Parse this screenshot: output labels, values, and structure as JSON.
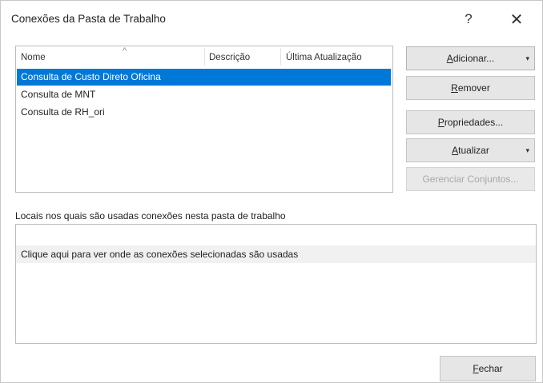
{
  "window": {
    "title": "Conexões da Pasta de Trabalho",
    "help_glyph": "?",
    "close_glyph": "✕"
  },
  "connections": {
    "columns": [
      "Nome",
      "Descrição",
      "Última Atualização"
    ],
    "sort_indicator": "^",
    "rows": [
      {
        "name": "Consulta de Custo Direto Oficina",
        "selected": true
      },
      {
        "name": "Consulta de MNT",
        "selected": false
      },
      {
        "name": "Consulta de RH_ori",
        "selected": false
      }
    ]
  },
  "buttons": {
    "add": {
      "mnemonic": "A",
      "rest": "dicionar...",
      "caret": "▾"
    },
    "remove": {
      "mnemonic": "R",
      "rest": "emover"
    },
    "properties": {
      "mnemonic": "P",
      "rest": "ropriedades..."
    },
    "refresh": {
      "mnemonic": "A",
      "rest": "tualizar",
      "caret": "▾"
    },
    "manage_sets": {
      "label": "Gerenciar Conjuntos..."
    },
    "close": {
      "mnemonic": "F",
      "rest": "echar"
    }
  },
  "locations": {
    "label": "Locais nos quais são usadas conexões nesta pasta de trabalho",
    "hint": "Clique aqui para ver onde as conexões selecionadas são usadas"
  },
  "colors": {
    "selection": "#0078d7",
    "button_bg": "#e6e6e6"
  }
}
